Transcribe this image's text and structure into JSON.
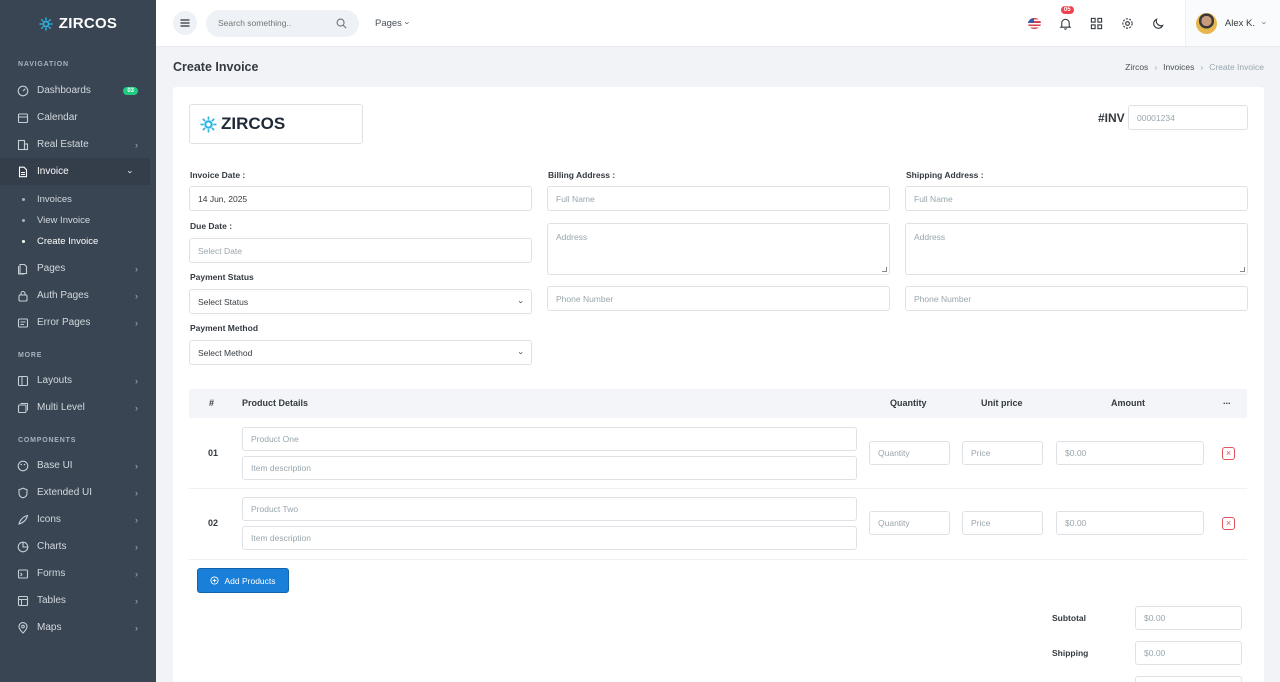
{
  "brand": {
    "name": "ZIRCOS"
  },
  "sidebar": {
    "sections": [
      "Navigation",
      "More",
      "Components"
    ],
    "items": [
      {
        "label": "Dashboards",
        "badge": "03"
      },
      {
        "label": "Calendar"
      },
      {
        "label": "Real Estate"
      },
      {
        "label": "Invoice"
      },
      {
        "label": "Pages"
      },
      {
        "label": "Auth Pages"
      },
      {
        "label": "Error Pages"
      },
      {
        "label": "Layouts"
      },
      {
        "label": "Multi Level"
      },
      {
        "label": "Base UI"
      },
      {
        "label": "Extended UI"
      },
      {
        "label": "Icons"
      },
      {
        "label": "Charts"
      },
      {
        "label": "Forms"
      },
      {
        "label": "Tables"
      },
      {
        "label": "Maps"
      }
    ],
    "invoice_sub": [
      "Invoices",
      "View Invoice",
      "Create Invoice"
    ]
  },
  "topbar": {
    "search_placeholder": "Search something..",
    "pages_label": "Pages",
    "notif_count": "05",
    "user_name": "Alex K."
  },
  "page": {
    "title": "Create Invoice",
    "breadcrumb": [
      "Zircos",
      "Invoices",
      "Create Invoice"
    ]
  },
  "form": {
    "inv_label": "#INV",
    "inv_number": "00001234",
    "invoice_date_label": "Invoice Date :",
    "invoice_date": "14 Jun, 2025",
    "due_date_label": "Due Date :",
    "due_date_placeholder": "Select Date",
    "payment_status_label": "Payment Status",
    "payment_status": "Select Status",
    "payment_method_label": "Payment Method",
    "payment_method": "Select Method",
    "billing_label": "Billing Address :",
    "shipping_label": "Shipping Address :",
    "full_name_ph": "Full Name",
    "address_ph": "Address",
    "phone_ph": "Phone Number"
  },
  "table": {
    "headers": [
      "#",
      "Product Details",
      "Quantity",
      "Unit price",
      "Amount",
      "..."
    ],
    "rows": [
      {
        "num": "01",
        "product_ph": "Product One",
        "desc_ph": "Item description",
        "qty_ph": "Quantity",
        "price_ph": "Price",
        "amount": "$0.00"
      },
      {
        "num": "02",
        "product_ph": "Product Two",
        "desc_ph": "Item description",
        "qty_ph": "Quantity",
        "price_ph": "Price",
        "amount": "$0.00"
      }
    ],
    "add_label": "Add Products"
  },
  "totals": {
    "subtotal_label": "Subtotal",
    "subtotal": "$0.00",
    "shipping_label": "Shipping",
    "shipping": "$0.00"
  }
}
